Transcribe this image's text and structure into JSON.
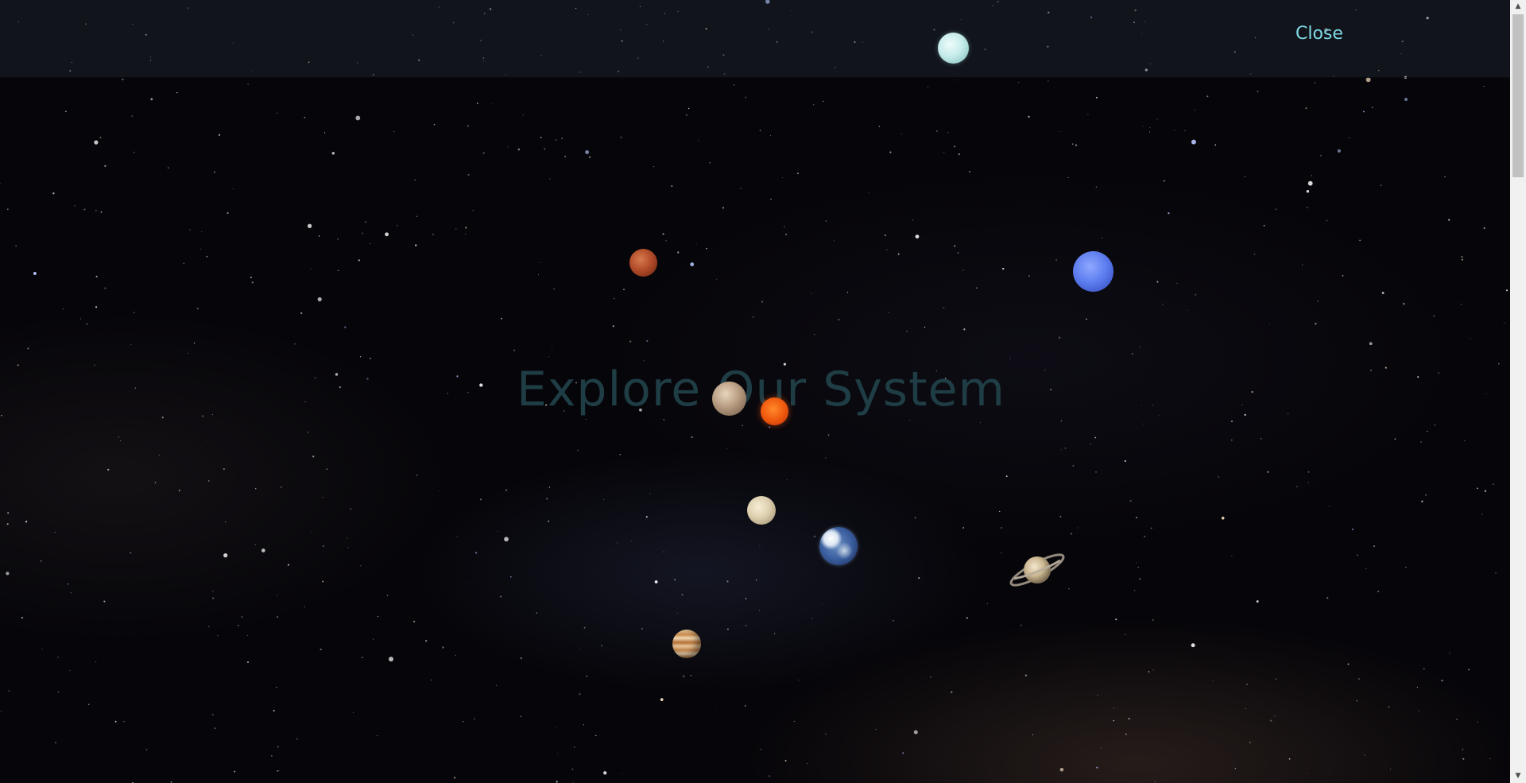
{
  "nav": {
    "close_label": "Close"
  },
  "hero": {
    "title": "Explore Our System"
  },
  "planets": [
    {
      "name": "Sun",
      "icon": "sun-icon"
    },
    {
      "name": "Mercury",
      "icon": "mercury-icon"
    },
    {
      "name": "Venus",
      "icon": "venus-icon"
    },
    {
      "name": "Earth",
      "icon": "earth-icon"
    },
    {
      "name": "Mars",
      "icon": "mars-icon"
    },
    {
      "name": "Jupiter",
      "icon": "jupiter-icon"
    },
    {
      "name": "Saturn",
      "icon": "saturn-icon"
    },
    {
      "name": "Uranus",
      "icon": "uranus-icon"
    },
    {
      "name": "Neptune",
      "icon": "neptune-icon"
    }
  ],
  "colors": {
    "accent": "#7fd9e6",
    "title": "#1f3d45",
    "background": "#060509"
  }
}
